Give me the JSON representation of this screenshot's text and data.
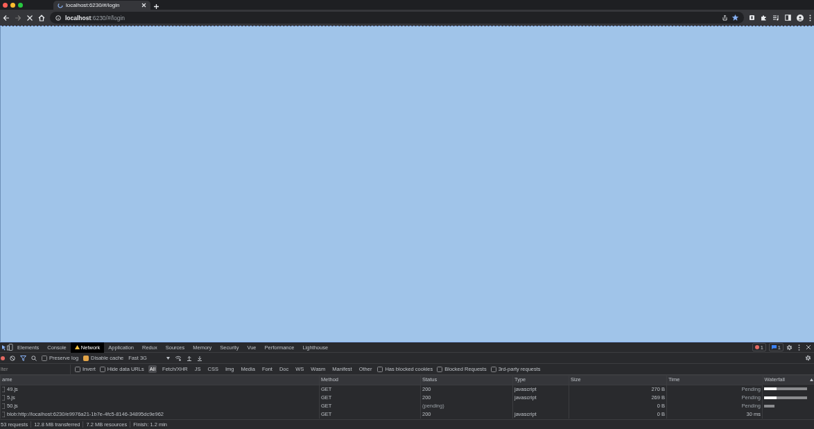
{
  "browser_tab": {
    "title": "localhost:6230/#/login",
    "loading": true
  },
  "address_bar": {
    "host": "localhost",
    "path": ":6230/#/login",
    "bookmarked": true
  },
  "devtools": {
    "tabs": [
      {
        "label": "Elements",
        "selected": false
      },
      {
        "label": "Console",
        "selected": false
      },
      {
        "label": "Network",
        "selected": true,
        "warning": true
      },
      {
        "label": "Application",
        "selected": false
      },
      {
        "label": "Redux",
        "selected": false
      },
      {
        "label": "Sources",
        "selected": false
      },
      {
        "label": "Memory",
        "selected": false
      },
      {
        "label": "Security",
        "selected": false
      },
      {
        "label": "Vue",
        "selected": false
      },
      {
        "label": "Performance",
        "selected": false
      },
      {
        "label": "Lighthouse",
        "selected": false
      }
    ],
    "error_count": "1",
    "message_count": "1",
    "toolbar": {
      "recording": true,
      "preserve_log": {
        "label": "Preserve log",
        "checked": false
      },
      "disable_cache": {
        "label": "Disable cache",
        "checked": true
      },
      "throttling": "Fast 3G"
    },
    "filter": {
      "placeholder": "lter"
    },
    "filter_options": [
      {
        "label": "Invert",
        "checked": false
      },
      {
        "label": "Hide data URLs",
        "checked": false
      }
    ],
    "resource_types": [
      {
        "label": "All",
        "selected": true
      },
      {
        "label": "Fetch/XHR",
        "selected": false
      },
      {
        "label": "JS",
        "selected": false
      },
      {
        "label": "CSS",
        "selected": false
      },
      {
        "label": "Img",
        "selected": false
      },
      {
        "label": "Media",
        "selected": false
      },
      {
        "label": "Font",
        "selected": false
      },
      {
        "label": "Doc",
        "selected": false
      },
      {
        "label": "WS",
        "selected": false
      },
      {
        "label": "Wasm",
        "selected": false
      },
      {
        "label": "Manifest",
        "selected": false
      },
      {
        "label": "Other",
        "selected": false
      }
    ],
    "extra_options": [
      {
        "label": "Has blocked cookies",
        "checked": false
      },
      {
        "label": "Blocked Requests",
        "checked": false
      },
      {
        "label": "3rd-party requests",
        "checked": false
      }
    ],
    "table": {
      "columns": [
        "ame",
        "Method",
        "Status",
        "Type",
        "Size",
        "Time",
        "Waterfall"
      ],
      "rows": [
        {
          "name": "49.js",
          "method": "GET",
          "status": "200",
          "type": "javascript",
          "size": "270 B",
          "time": "Pending",
          "kind": "loading"
        },
        {
          "name": "5.js",
          "method": "GET",
          "status": "200",
          "type": "javascript",
          "size": "269 B",
          "time": "Pending",
          "kind": "loading"
        },
        {
          "name": "50.js",
          "method": "GET",
          "status": "(pending)",
          "type": "",
          "size": "0 B",
          "time": "Pending",
          "kind": "queued"
        },
        {
          "name": "blob:http://localhost:6230/e9976a21-1b7e-4fc5-8146-34895dc9e962",
          "method": "GET",
          "status": "200",
          "type": "javascript",
          "size": "0 B",
          "time": "30 ms",
          "kind": "none"
        }
      ]
    },
    "summary": [
      {
        "text": "53 requests"
      },
      {
        "text": "12.8 MB transferred"
      },
      {
        "text": "7.2 MB resources"
      },
      {
        "text": "Finish: 1.2 min"
      }
    ]
  }
}
